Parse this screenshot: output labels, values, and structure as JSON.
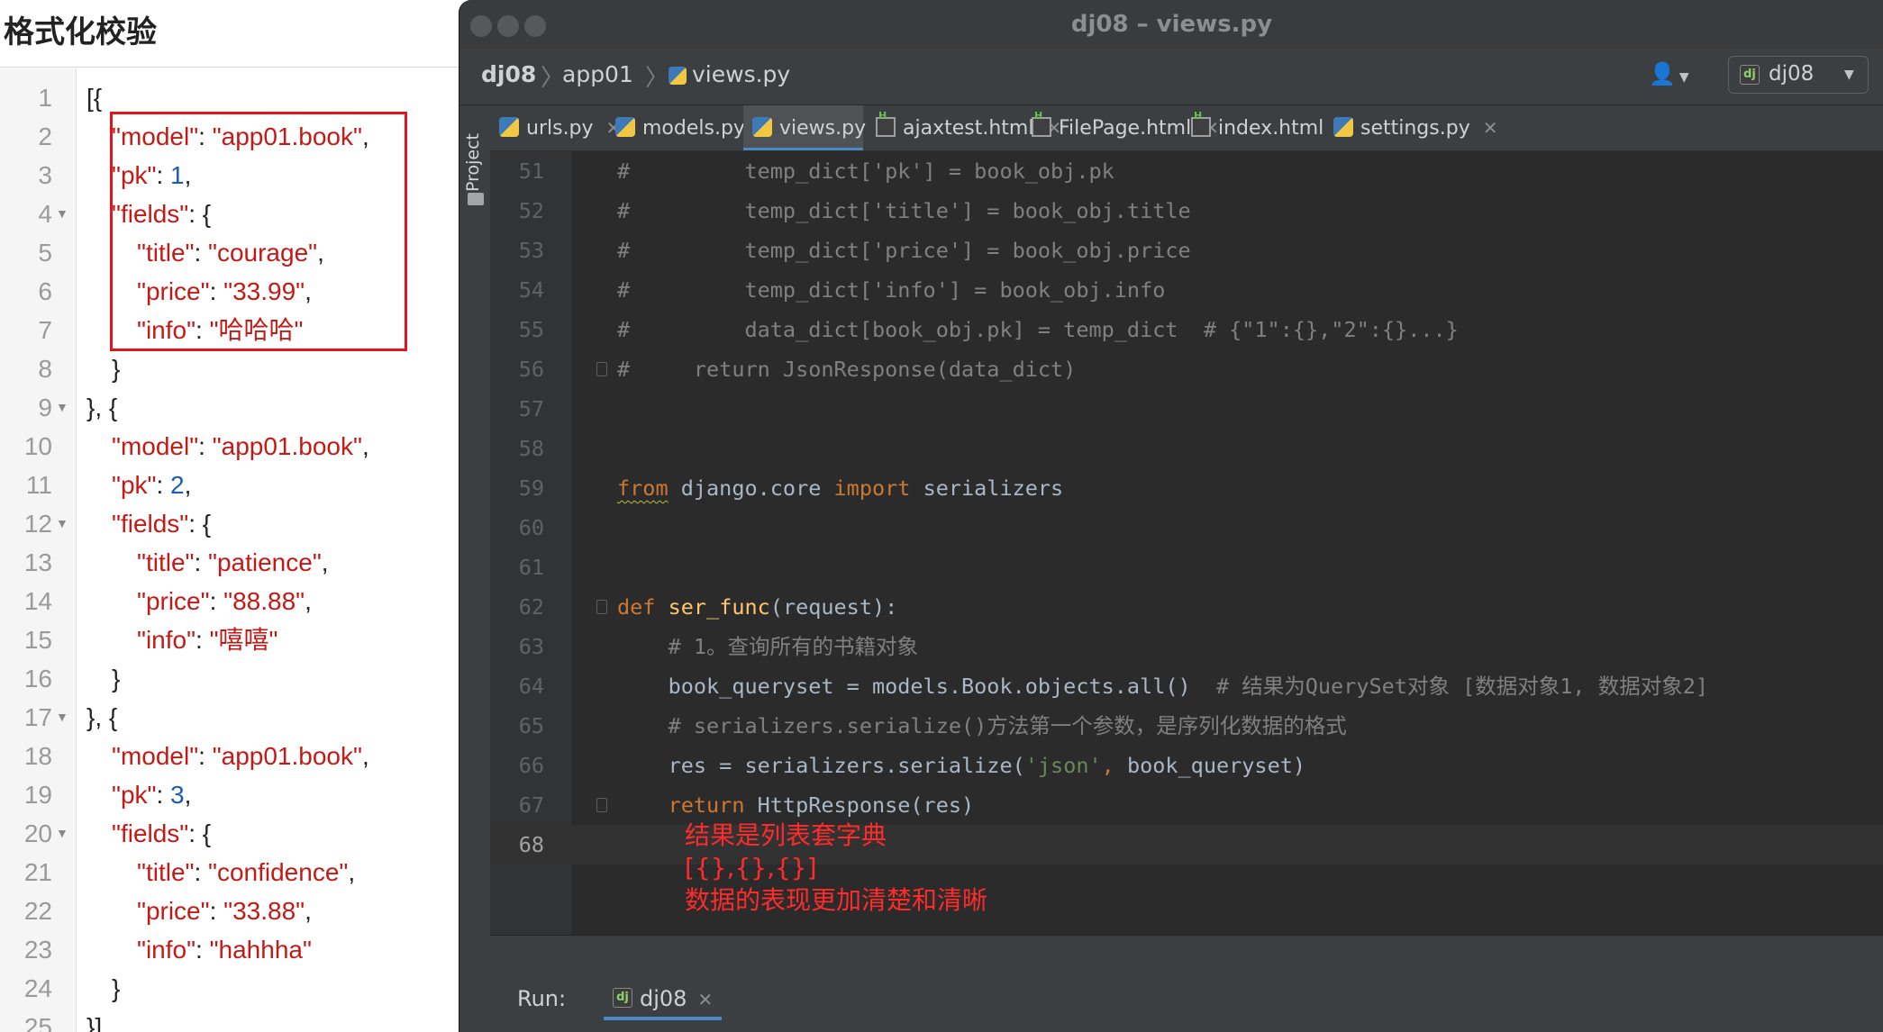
{
  "left_panel": {
    "title": "格式化校验",
    "lines": [
      {
        "n": "1",
        "fold": false,
        "indent": 0,
        "parts": [
          [
            "p",
            "[{"
          ]
        ]
      },
      {
        "n": "2",
        "fold": false,
        "indent": 1,
        "parts": [
          [
            "k",
            "\"model\""
          ],
          [
            "p",
            ": "
          ],
          [
            "v",
            "\"app01.book\""
          ],
          [
            "p",
            ","
          ]
        ]
      },
      {
        "n": "3",
        "fold": false,
        "indent": 1,
        "parts": [
          [
            "k",
            "\"pk\""
          ],
          [
            "p",
            ": "
          ],
          [
            "n",
            "1"
          ],
          [
            "p",
            ","
          ]
        ]
      },
      {
        "n": "4",
        "fold": true,
        "indent": 1,
        "parts": [
          [
            "k",
            "\"fields\""
          ],
          [
            "p",
            ": {"
          ]
        ]
      },
      {
        "n": "5",
        "fold": false,
        "indent": 2,
        "parts": [
          [
            "k",
            "\"title\""
          ],
          [
            "p",
            ": "
          ],
          [
            "v",
            "\"courage\""
          ],
          [
            "p",
            ","
          ]
        ]
      },
      {
        "n": "6",
        "fold": false,
        "indent": 2,
        "parts": [
          [
            "k",
            "\"price\""
          ],
          [
            "p",
            ": "
          ],
          [
            "v",
            "\"33.99\""
          ],
          [
            "p",
            ","
          ]
        ]
      },
      {
        "n": "7",
        "fold": false,
        "indent": 2,
        "parts": [
          [
            "k",
            "\"info\""
          ],
          [
            "p",
            ": "
          ],
          [
            "v",
            "\"哈哈哈\""
          ]
        ]
      },
      {
        "n": "8",
        "fold": false,
        "indent": 1,
        "parts": [
          [
            "p",
            "}"
          ]
        ]
      },
      {
        "n": "9",
        "fold": true,
        "indent": 0,
        "parts": [
          [
            "p",
            "}, {"
          ]
        ]
      },
      {
        "n": "10",
        "fold": false,
        "indent": 1,
        "parts": [
          [
            "k",
            "\"model\""
          ],
          [
            "p",
            ": "
          ],
          [
            "v",
            "\"app01.book\""
          ],
          [
            "p",
            ","
          ]
        ]
      },
      {
        "n": "11",
        "fold": false,
        "indent": 1,
        "parts": [
          [
            "k",
            "\"pk\""
          ],
          [
            "p",
            ": "
          ],
          [
            "n",
            "2"
          ],
          [
            "p",
            ","
          ]
        ]
      },
      {
        "n": "12",
        "fold": true,
        "indent": 1,
        "parts": [
          [
            "k",
            "\"fields\""
          ],
          [
            "p",
            ": {"
          ]
        ]
      },
      {
        "n": "13",
        "fold": false,
        "indent": 2,
        "parts": [
          [
            "k",
            "\"title\""
          ],
          [
            "p",
            ": "
          ],
          [
            "v",
            "\"patience\""
          ],
          [
            "p",
            ","
          ]
        ]
      },
      {
        "n": "14",
        "fold": false,
        "indent": 2,
        "parts": [
          [
            "k",
            "\"price\""
          ],
          [
            "p",
            ": "
          ],
          [
            "v",
            "\"88.88\""
          ],
          [
            "p",
            ","
          ]
        ]
      },
      {
        "n": "15",
        "fold": false,
        "indent": 2,
        "parts": [
          [
            "k",
            "\"info\""
          ],
          [
            "p",
            ": "
          ],
          [
            "v",
            "\"嘻嘻\""
          ]
        ]
      },
      {
        "n": "16",
        "fold": false,
        "indent": 1,
        "parts": [
          [
            "p",
            "}"
          ]
        ]
      },
      {
        "n": "17",
        "fold": true,
        "indent": 0,
        "parts": [
          [
            "p",
            "}, {"
          ]
        ]
      },
      {
        "n": "18",
        "fold": false,
        "indent": 1,
        "parts": [
          [
            "k",
            "\"model\""
          ],
          [
            "p",
            ": "
          ],
          [
            "v",
            "\"app01.book\""
          ],
          [
            "p",
            ","
          ]
        ]
      },
      {
        "n": "19",
        "fold": false,
        "indent": 1,
        "parts": [
          [
            "k",
            "\"pk\""
          ],
          [
            "p",
            ": "
          ],
          [
            "n",
            "3"
          ],
          [
            "p",
            ","
          ]
        ]
      },
      {
        "n": "20",
        "fold": true,
        "indent": 1,
        "parts": [
          [
            "k",
            "\"fields\""
          ],
          [
            "p",
            ": {"
          ]
        ]
      },
      {
        "n": "21",
        "fold": false,
        "indent": 2,
        "parts": [
          [
            "k",
            "\"title\""
          ],
          [
            "p",
            ": "
          ],
          [
            "v",
            "\"confidence\""
          ],
          [
            "p",
            ","
          ]
        ]
      },
      {
        "n": "22",
        "fold": false,
        "indent": 2,
        "parts": [
          [
            "k",
            "\"price\""
          ],
          [
            "p",
            ": "
          ],
          [
            "v",
            "\"33.88\""
          ],
          [
            "p",
            ","
          ]
        ]
      },
      {
        "n": "23",
        "fold": false,
        "indent": 2,
        "parts": [
          [
            "k",
            "\"info\""
          ],
          [
            "p",
            ": "
          ],
          [
            "v",
            "\"hahhha\""
          ]
        ]
      },
      {
        "n": "24",
        "fold": false,
        "indent": 1,
        "parts": [
          [
            "p",
            "}"
          ]
        ]
      },
      {
        "n": "25",
        "fold": false,
        "indent": 0,
        "parts": [
          [
            "p",
            "}]"
          ]
        ]
      }
    ]
  },
  "ide": {
    "window_title": "dj08 – views.py",
    "breadcrumb": {
      "project": "dj08",
      "folder": "app01",
      "file": "views.py"
    },
    "run_config": "dj08",
    "side_tab": "Project",
    "tabs": [
      {
        "label": "urls.py",
        "icon": "python-file-icon",
        "active": false
      },
      {
        "label": "models.py",
        "icon": "python-file-icon",
        "active": false
      },
      {
        "label": "views.py",
        "icon": "python-file-icon",
        "active": true
      },
      {
        "label": "ajaxtest.html",
        "icon": "html-file-icon",
        "active": false
      },
      {
        "label": "FilePage.html",
        "icon": "html-file-icon",
        "active": false
      },
      {
        "label": "index.html",
        "icon": "html-file-icon",
        "active": false
      },
      {
        "label": "settings.py",
        "icon": "python-file-icon",
        "active": false
      }
    ],
    "code": [
      {
        "n": "51",
        "parts": [
          [
            "cm",
            "#         temp_dict['pk'] = book_obj.pk"
          ]
        ]
      },
      {
        "n": "52",
        "parts": [
          [
            "cm",
            "#         temp_dict['title'] = book_obj.title"
          ]
        ]
      },
      {
        "n": "53",
        "parts": [
          [
            "cm",
            "#         temp_dict['price'] = book_obj.price"
          ]
        ]
      },
      {
        "n": "54",
        "parts": [
          [
            "cm",
            "#         temp_dict['info'] = book_obj.info"
          ]
        ]
      },
      {
        "n": "55",
        "parts": [
          [
            "cm",
            "#         data_dict[book_obj.pk] = temp_dict  # {\"1\":{},\"2\":{}...}"
          ]
        ]
      },
      {
        "n": "56",
        "fold": true,
        "parts": [
          [
            "cm",
            "#     return JsonResponse(data_dict)"
          ]
        ]
      },
      {
        "n": "57",
        "parts": []
      },
      {
        "n": "58",
        "parts": []
      },
      {
        "n": "59",
        "parts": [
          [
            "kwv",
            "from"
          ],
          [
            "t",
            " django.core "
          ],
          [
            "kw",
            "import"
          ],
          [
            "t",
            " serializers"
          ]
        ]
      },
      {
        "n": "60",
        "parts": []
      },
      {
        "n": "61",
        "parts": []
      },
      {
        "n": "62",
        "fold": true,
        "parts": [
          [
            "kw",
            "def"
          ],
          [
            "t",
            " "
          ],
          [
            "fn",
            "ser_func"
          ],
          [
            "t",
            "(request):"
          ]
        ]
      },
      {
        "n": "63",
        "parts": [
          [
            "cm",
            "    # 1。查询所有的书籍对象"
          ]
        ]
      },
      {
        "n": "64",
        "parts": [
          [
            "t",
            "    book_queryset = models.Book.objects.all()  "
          ],
          [
            "cm",
            "# 结果为QuerySet对象 [数据对象1, 数据对象2]"
          ]
        ]
      },
      {
        "n": "65",
        "parts": [
          [
            "cm",
            "    # serializers.serialize()方法第一个参数，是序列化数据的格式"
          ]
        ]
      },
      {
        "n": "66",
        "parts": [
          [
            "t",
            "    res = serializers.serialize("
          ],
          [
            "str",
            "'json'"
          ],
          [
            "kw",
            ","
          ],
          [
            "t",
            " book_queryset)"
          ]
        ]
      },
      {
        "n": "67",
        "fold": true,
        "parts": [
          [
            "t",
            "    "
          ],
          [
            "kw",
            "return"
          ],
          [
            "t",
            " HttpResponse(res)"
          ]
        ]
      },
      {
        "n": "68",
        "current": true,
        "parts": []
      }
    ],
    "annotation": {
      "line1": "结果是列表套字典",
      "line2": "[{},{},{}]",
      "line3": "数据的表现更加清楚和清晰"
    },
    "run_panel": {
      "label": "Run:",
      "tab": "dj08"
    }
  }
}
